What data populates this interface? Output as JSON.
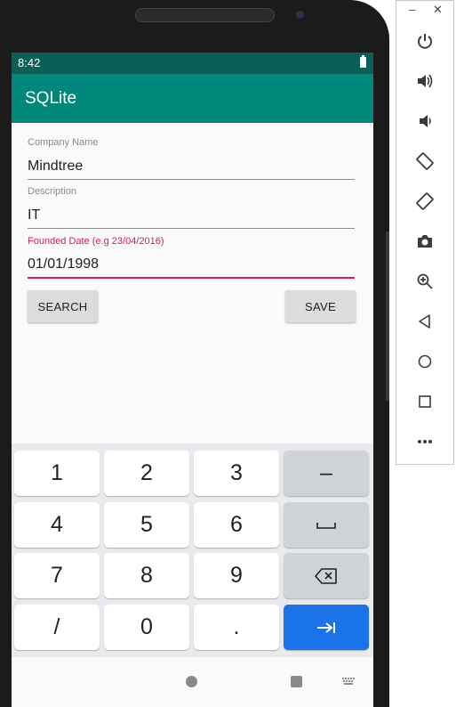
{
  "status_bar": {
    "time": "8:42"
  },
  "app_bar": {
    "title": "SQLite"
  },
  "form": {
    "company_name": {
      "label": "Company Name",
      "value": "Mindtree"
    },
    "description": {
      "label": "Description",
      "value": "IT"
    },
    "founded_date": {
      "label": "Founded Date (e.g 23/04/2016)",
      "value": "01/01/1998"
    },
    "search_label": "SEARCH",
    "save_label": "SAVE"
  },
  "keyboard": {
    "keys": [
      "1",
      "2",
      "3",
      "–",
      "4",
      "5",
      "6",
      "␣",
      "7",
      "8",
      "9",
      "backspace",
      "/",
      "0",
      ".",
      "next"
    ]
  },
  "emulator_toolbar": {
    "buttons": [
      "minimize",
      "close",
      "power",
      "volume-up",
      "volume-down",
      "rotate-left",
      "rotate-right",
      "screenshot",
      "zoom",
      "back",
      "home",
      "overview",
      "more"
    ]
  },
  "colors": {
    "status_bar": "#0a5f56",
    "app_bar": "#00897b",
    "focus_accent": "#d81b60",
    "enter_key": "#1a73e8"
  }
}
